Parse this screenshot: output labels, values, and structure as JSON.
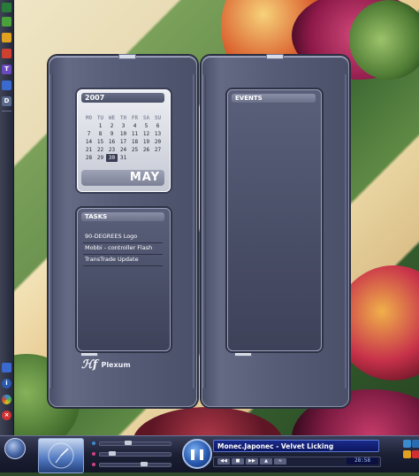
{
  "calendar": {
    "year": "2007",
    "month": "MAY",
    "weekdays": [
      "MO",
      "TU",
      "WE",
      "TH",
      "FR",
      "SA",
      "SU"
    ],
    "weeks": [
      [
        "",
        "1",
        "2",
        "3",
        "4",
        "5",
        "6"
      ],
      [
        "7",
        "8",
        "9",
        "10",
        "11",
        "12",
        "13"
      ],
      [
        "14",
        "15",
        "16",
        "17",
        "18",
        "19",
        "20"
      ],
      [
        "21",
        "22",
        "23",
        "24",
        "25",
        "26",
        "27"
      ],
      [
        "28",
        "29",
        "30",
        "31",
        "",
        "",
        ""
      ]
    ],
    "today": "30"
  },
  "tasks": {
    "title": "TASKS",
    "items": [
      "90-DEGREES Logo",
      "Mobbi - controller Flash",
      "TransTrade Update"
    ]
  },
  "events": {
    "title": "EVENTS"
  },
  "brand": {
    "mark": "ℋf",
    "name": "Plexum"
  },
  "player": {
    "now_playing": "Monec.Japonec - Velvet Licking",
    "time": "28:58",
    "play_symbol": "❚❚"
  },
  "dock": {
    "letters": [
      "",
      "",
      "",
      "",
      "T",
      "",
      "D"
    ],
    "colors": [
      "#2a7a3a",
      "#4aa03a",
      "#e0a020",
      "#d04030",
      "#6a4ac0",
      "#3a6ad0",
      "#5a6a8a"
    ]
  },
  "tray": {
    "colors": [
      "#3a8ad0",
      "#2a6ab0",
      "#e0a020",
      "#d03030"
    ]
  }
}
